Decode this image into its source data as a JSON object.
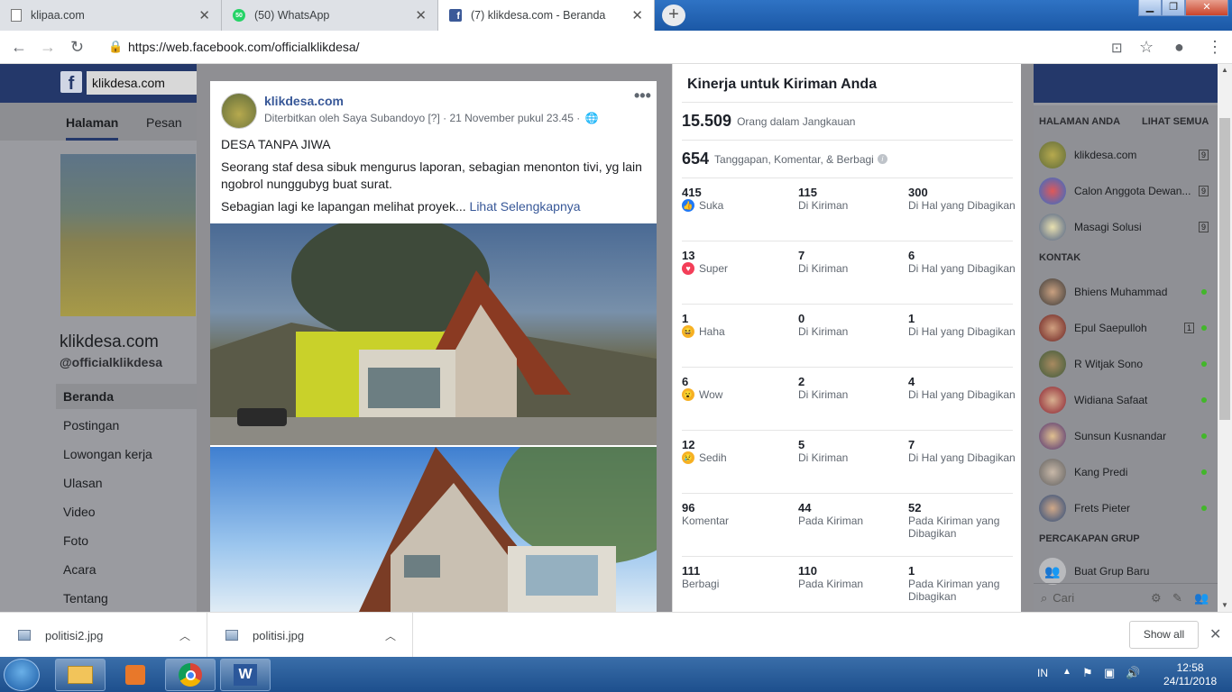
{
  "browser": {
    "tabs": [
      {
        "title": "klipaa.com",
        "icon": "document-icon"
      },
      {
        "title": "(50) WhatsApp",
        "icon": "whatsapp-icon",
        "badge": "50"
      },
      {
        "title": "(7) klikdesa.com - Beranda",
        "icon": "facebook-icon",
        "active": true
      }
    ],
    "url": "https://web.facebook.com/officialklikdesa/"
  },
  "facebook": {
    "search_value": "klikdesa.com",
    "page_tabs": [
      "Halaman",
      "Pesan"
    ],
    "page_name": "klikdesa.com",
    "page_handle": "@officialklikdesa",
    "nav": [
      "Beranda",
      "Postingan",
      "Lowongan kerja",
      "Ulasan",
      "Video",
      "Foto",
      "Acara",
      "Tentang"
    ]
  },
  "post": {
    "page_name": "klikdesa.com",
    "meta": "Diterbitkan oleh Saya Subandoyo [?] · 21 November pukul 23.45 ·",
    "title": "DESA TANPA JIWA",
    "paragraph1": "Seorang staf desa sibuk mengurus laporan, sebagian menonton tivi, yg lain ngobrol nunggubyg buat surat.",
    "paragraph2": "Sebagian lagi ke lapangan melihat proyek...",
    "see_more": "Lihat Selengkapnya"
  },
  "insights": {
    "title": "Kinerja untuk Kiriman Anda",
    "reach": {
      "value": "15.509",
      "label": "Orang dalam Jangkauan"
    },
    "engagement": {
      "value": "654",
      "label": "Tanggapan, Komentar, & Berbagi"
    },
    "rows": [
      {
        "total": "415",
        "label": "Suka",
        "icon": "like-icon",
        "color": "#2078f4",
        "on_post": "115",
        "on_post_label": "Di Kiriman",
        "on_shares": "300",
        "on_shares_label": "Di Hal yang Dibagikan"
      },
      {
        "total": "13",
        "label": "Super",
        "icon": "love-icon",
        "color": "#f33e58",
        "on_post": "7",
        "on_post_label": "Di Kiriman",
        "on_shares": "6",
        "on_shares_label": "Di Hal yang Dibagikan"
      },
      {
        "total": "1",
        "label": "Haha",
        "icon": "haha-icon",
        "color": "#f7b125",
        "on_post": "0",
        "on_post_label": "Di Kiriman",
        "on_shares": "1",
        "on_shares_label": "Di Hal yang Dibagikan"
      },
      {
        "total": "6",
        "label": "Wow",
        "icon": "wow-icon",
        "color": "#f7b125",
        "on_post": "2",
        "on_post_label": "Di Kiriman",
        "on_shares": "4",
        "on_shares_label": "Di Hal yang Dibagikan"
      },
      {
        "total": "12",
        "label": "Sedih",
        "icon": "sad-icon",
        "color": "#f7b125",
        "on_post": "5",
        "on_post_label": "Di Kiriman",
        "on_shares": "7",
        "on_shares_label": "Di Hal yang Dibagikan"
      },
      {
        "total": "96",
        "label": "Komentar",
        "icon": "",
        "color": "",
        "on_post": "44",
        "on_post_label": "Pada Kiriman",
        "on_shares": "52",
        "on_shares_label": "Pada Kiriman yang Dibagikan"
      },
      {
        "total": "111",
        "label": "Berbagi",
        "icon": "",
        "color": "",
        "on_post": "110",
        "on_post_label": "Pada Kiriman",
        "on_shares": "1",
        "on_shares_label": "Pada Kiriman yang Dibagikan"
      }
    ]
  },
  "sidebar": {
    "pages_header": "HALAMAN ANDA",
    "see_all": "LIHAT SEMUA",
    "pages": [
      {
        "name": "klikdesa.com",
        "count": "9"
      },
      {
        "name": "Calon Anggota Dewan...",
        "count": "9"
      },
      {
        "name": "Masagi Solusi",
        "count": "9"
      }
    ],
    "contacts_header": "KONTAK",
    "contacts": [
      {
        "name": "Bhiens Muhammad",
        "online": true
      },
      {
        "name": "Epul Saepulloh",
        "count": "1"
      },
      {
        "name": "R Witjak Sono",
        "online": true
      },
      {
        "name": "Widiana Safaat",
        "online": true
      },
      {
        "name": "Sunsun Kusnandar",
        "online": true
      },
      {
        "name": "Kang Predi",
        "online": true
      },
      {
        "name": "Frets Pieter",
        "online": true
      }
    ],
    "groups_header": "PERCAKAPAN GRUP",
    "new_group": "Buat Grup Baru",
    "search_placeholder": "Cari"
  },
  "downloads": {
    "items": [
      "politisi2.jpg",
      "politisi.jpg"
    ],
    "show_all": "Show all"
  },
  "taskbar": {
    "lang": "IN",
    "time": "12:58",
    "date": "24/11/2018"
  }
}
